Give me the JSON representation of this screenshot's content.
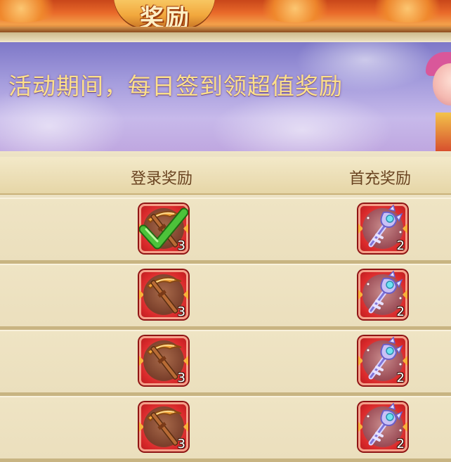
{
  "header": {
    "title": "奖励"
  },
  "banner": {
    "text": "活动期间，每日签到领超值奖励"
  },
  "table": {
    "columns": [
      "登录奖励",
      "首充奖励"
    ],
    "rows": [
      {
        "login_reward": {
          "icon": "pickaxe-icon",
          "count": "3",
          "claimed": true
        },
        "recharge_reward": {
          "icon": "crystal-key-icon",
          "count": "2"
        }
      },
      {
        "login_reward": {
          "icon": "pickaxe-icon",
          "count": "3",
          "claimed": false
        },
        "recharge_reward": {
          "icon": "crystal-key-icon",
          "count": "2"
        }
      },
      {
        "login_reward": {
          "icon": "pickaxe-icon",
          "count": "3",
          "claimed": false
        },
        "recharge_reward": {
          "icon": "crystal-key-icon",
          "count": "2"
        }
      },
      {
        "login_reward": {
          "icon": "pickaxe-icon",
          "count": "3",
          "claimed": false
        },
        "recharge_reward": {
          "icon": "crystal-key-icon",
          "count": "2"
        }
      }
    ]
  },
  "colors": {
    "accent_text": "#fde08a",
    "header_text": "#6a4421",
    "slot_red": "#d8282a",
    "check_green": "#4cc23a"
  }
}
